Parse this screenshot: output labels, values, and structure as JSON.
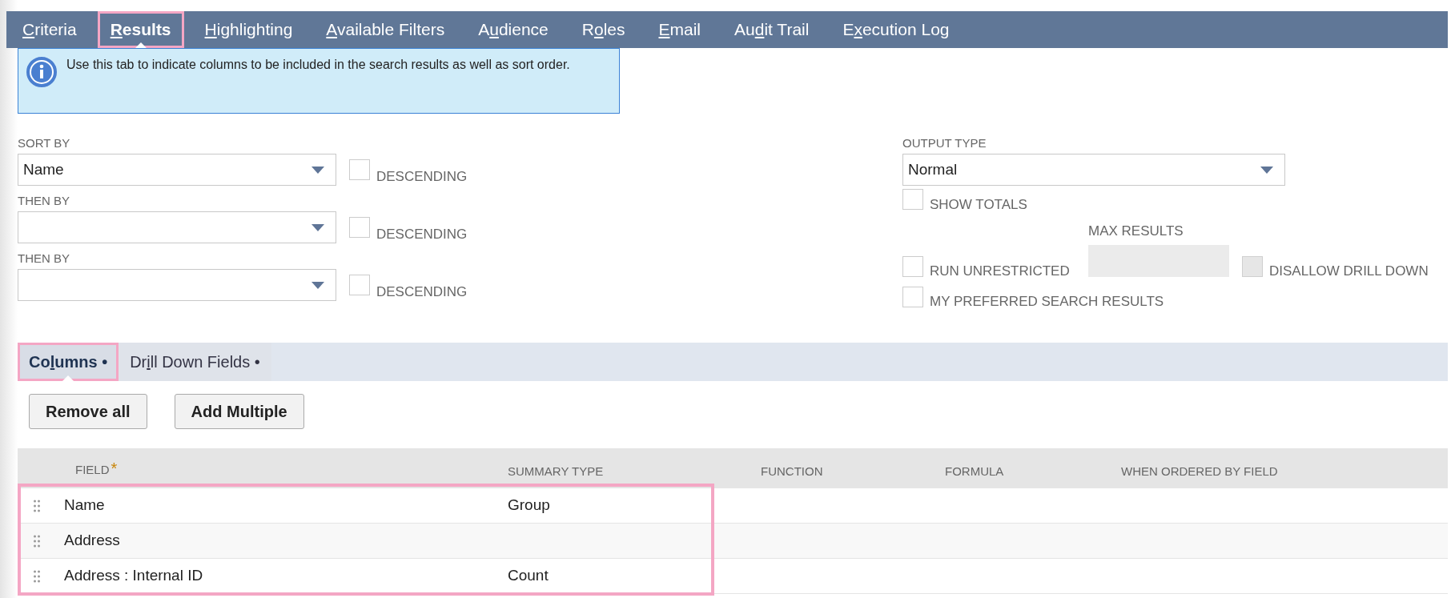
{
  "tabs": [
    {
      "key": "C",
      "post": "riteria",
      "selected": false,
      "highlighted": false
    },
    {
      "key": "R",
      "post": "esults",
      "selected": true,
      "highlighted": true
    },
    {
      "key": "H",
      "post": "ighlighting",
      "selected": false,
      "highlighted": false
    },
    {
      "key": "A",
      "post": "vailable Filters",
      "selected": false,
      "highlighted": false
    },
    {
      "pre": "A",
      "key": "u",
      "post": "dience",
      "selected": false,
      "highlighted": false
    },
    {
      "pre": "R",
      "key": "o",
      "post": "les",
      "selected": false,
      "highlighted": false
    },
    {
      "key": "E",
      "post": "mail",
      "selected": false,
      "highlighted": false
    },
    {
      "pre": "Au",
      "key": "d",
      "post": "it Trail",
      "selected": false,
      "highlighted": false
    },
    {
      "pre": "E",
      "key": "x",
      "post": "ecution Log",
      "selected": false,
      "highlighted": false
    }
  ],
  "info": "Use this tab to indicate columns to be included in the search results as well as sort order.",
  "sort_fields": [
    {
      "label": "SORT BY",
      "value": "Name",
      "descending_label": "DESCENDING",
      "descending": false
    },
    {
      "label": "THEN BY",
      "descending_label": "DESCENDING",
      "descending": false
    },
    {
      "label": "THEN BY",
      "descending_label": "DESCENDING",
      "descending": false
    }
  ],
  "output_type": {
    "label": "OUTPUT TYPE",
    "value": "Normal"
  },
  "show_totals": {
    "label": "SHOW TOTALS",
    "checked": false
  },
  "run_unrestricted": {
    "label": "RUN UNRESTRICTED",
    "checked": false
  },
  "max_results": {
    "label": "MAX RESULTS",
    "disabled": true
  },
  "disallow_drill_down": {
    "label": "DISALLOW DRILL DOWN",
    "checked": false,
    "disabled": true
  },
  "preferred": {
    "label": "MY PREFERRED SEARCH RESULTS",
    "checked": false
  },
  "subtabs": [
    {
      "pre": "Co",
      "key": "l",
      "post": "umns",
      "dot": "•",
      "selected": true,
      "highlighted": true
    },
    {
      "pre": "Dr",
      "key": "i",
      "post": "ll Down Fields",
      "dot": "•",
      "selected": false,
      "highlighted": false
    }
  ],
  "buttons": [
    "Remove all",
    "Add Multiple"
  ],
  "table": {
    "columns": [
      "FIELD",
      "SUMMARY TYPE",
      "FUNCTION",
      "FORMULA",
      "WHEN ORDERED BY FIELD"
    ],
    "required_mark": "*",
    "rows_highlighted": true,
    "rows": [
      {
        "field": "Name",
        "summary_type": "Group"
      },
      {
        "field": "Address"
      },
      {
        "field": "Address : Internal ID",
        "summary_type": "Count"
      }
    ]
  }
}
